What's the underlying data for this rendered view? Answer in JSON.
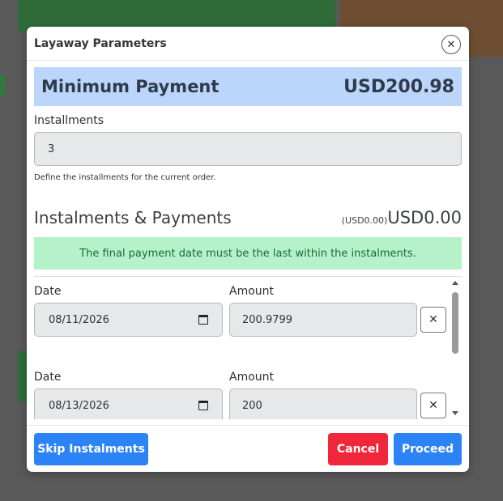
{
  "modal": {
    "title": "Layaway Parameters",
    "close_glyph": "✕"
  },
  "minimum_payment": {
    "label": "Minimum Payment",
    "value": "USD200.98"
  },
  "installments": {
    "label": "Installments",
    "value": "3",
    "help": "Define the installments for the current order."
  },
  "section": {
    "title": "Instalments & Payments",
    "sub_total": "(USD0.00)",
    "total": "USD0.00"
  },
  "alert": {
    "text": "The final payment date must be the last within the instalments."
  },
  "payments": [
    {
      "date_label": "Date",
      "amount_label": "Amount",
      "date": "08/11/2026",
      "amount": "200.9799",
      "remove_glyph": "✕"
    },
    {
      "date_label": "Date",
      "amount_label": "Amount",
      "date": "08/13/2026",
      "amount": "200",
      "remove_glyph": "✕"
    }
  ],
  "footer": {
    "skip_label": "Skip Instalments",
    "cancel_label": "Cancel",
    "proceed_label": "Proceed"
  },
  "colors": {
    "primary": "#2c83f6",
    "danger": "#f0263a",
    "success_bg": "#b6f2c9",
    "success_text": "#1b6b36",
    "highlight_bg": "#bcd6fb"
  }
}
